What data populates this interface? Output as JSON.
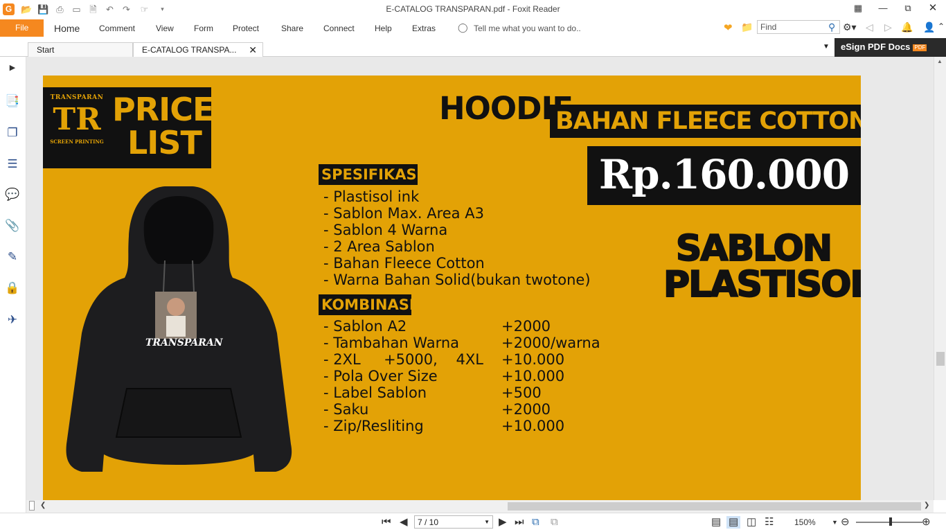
{
  "app": {
    "title": "E-CATALOG TRANSPARAN.pdf - Foxit Reader"
  },
  "menu": {
    "file": "File",
    "items": [
      "Home",
      "Comment",
      "View",
      "Form",
      "Protect",
      "Share",
      "Connect",
      "Help",
      "Extras"
    ],
    "tell_me": "Tell me what you want to do.."
  },
  "search": {
    "placeholder": "Find"
  },
  "tabs": [
    {
      "label": "Start"
    },
    {
      "label": "E-CATALOG TRANSPA..."
    }
  ],
  "esign": {
    "label": "eSign PDF Docs",
    "badge": "PDF"
  },
  "document": {
    "logo_top": "TRANSPARAN",
    "logo_bottom": "SCREEN PRINTING",
    "price_list": [
      "PRICE",
      "LIST"
    ],
    "product": "HOODIE",
    "material": "BAHAN FLEECE COTTON",
    "price": "Rp.160.000",
    "spec_heading": "SPESIFIKASI",
    "specs": [
      "- Plastisol ink",
      "- Sablon Max. Area A3",
      "- Sablon 4 Warna",
      "- 2 Area Sablon",
      "- Bahan Fleece Cotton",
      "- Warna Bahan Solid(bukan twotone)"
    ],
    "combo_heading": "KOMBINASI",
    "combos": [
      {
        "name": "- Sablon A2",
        "price": "+2000"
      },
      {
        "name": "- Tambahan Warna",
        "price": "+2000/warna"
      },
      {
        "name": "- 2XL     +5000,    4XL",
        "price": "+10.000"
      },
      {
        "name": "- Pola Over Size",
        "price": "+10.000"
      },
      {
        "name": "- Label Sablon",
        "price": "+500"
      },
      {
        "name": "- Saku",
        "price": "+2000"
      },
      {
        "name": "- Zip/Resliting",
        "price": "+10.000"
      }
    ],
    "sablon": [
      "SABLON",
      "PLASTISOL"
    ],
    "hoodie_print": "TRANSPARAN"
  },
  "status": {
    "page": "7 / 10",
    "zoom": "150%"
  },
  "colors": {
    "accent": "#f5881f",
    "page_bg": "#e3a206",
    "dark": "#1a1a1a"
  }
}
